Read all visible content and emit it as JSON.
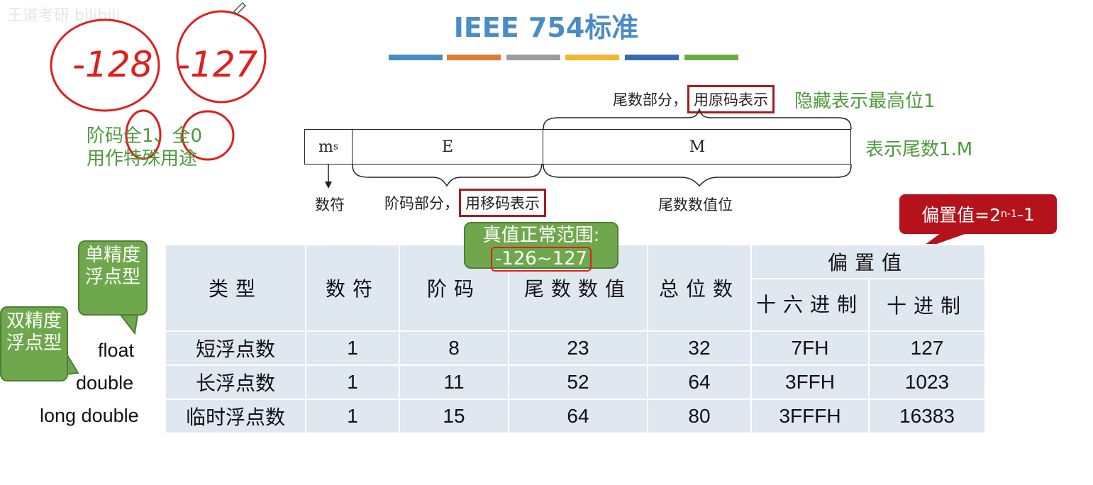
{
  "watermark": "王道考研 bilibili",
  "title": "IEEE 754标准",
  "color_bars": [
    "#4a8cc6",
    "#e07a34",
    "#9c9c9c",
    "#f1b82d",
    "#3b68b3",
    "#6aad45"
  ],
  "handwriting": {
    "neg128": "-128",
    "neg127": "-127"
  },
  "notes": {
    "exp_special_line1": "阶码全1、全0",
    "exp_special_line2": "用作特殊用途",
    "hidden_bit": "隐藏表示最高位1",
    "mantissa_repr": "表示尾数1.M"
  },
  "format": {
    "top_label_prefix": "尾数部分，",
    "top_label_boxed": "用原码表示",
    "field_ms": "m",
    "field_ms_sub": "s",
    "field_e": "E",
    "field_m": "M",
    "label_sign": "数符",
    "label_exp_prefix": "阶码部分，",
    "label_exp_boxed": "用移码表示",
    "label_mantissa": "尾数数值位"
  },
  "callouts": {
    "bias_prefix": "偏置值=2",
    "bias_sup": "n-1",
    "bias_suffix": " -1",
    "range_title": "真值正常范围:",
    "range_value": "-126~127",
    "single_precision": "单精度浮点型",
    "double_precision": "双精度浮点型"
  },
  "table": {
    "headers": {
      "type": "类型",
      "sign": "数符",
      "exponent": "阶码",
      "mantissa": "尾数数值",
      "total": "总位数",
      "bias": "偏置值",
      "hex": "十六进制",
      "dec": "十进制"
    },
    "rows": [
      {
        "lang": "float",
        "type": "短浮点数",
        "sign": "1",
        "exponent": "8",
        "mantissa": "23",
        "total": "32",
        "hex": "7FH",
        "dec": "127"
      },
      {
        "lang": "double",
        "type": "长浮点数",
        "sign": "1",
        "exponent": "11",
        "mantissa": "52",
        "total": "64",
        "hex": "3FFH",
        "dec": "1023"
      },
      {
        "lang": "long double",
        "type": "临时浮点数",
        "sign": "1",
        "exponent": "15",
        "mantissa": "64",
        "total": "80",
        "hex": "3FFFH",
        "dec": "16383"
      }
    ]
  }
}
